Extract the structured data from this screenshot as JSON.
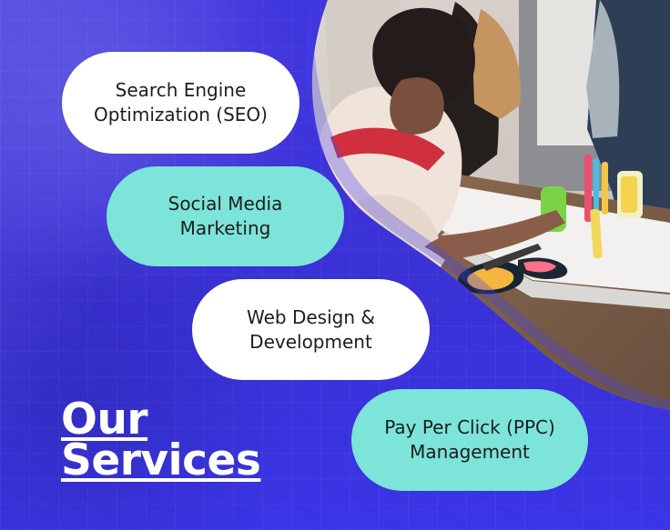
{
  "services": {
    "seo": "Search Engine\nOptimization (SEO)",
    "smm": "Social Media\nMarketing",
    "web": "Web Design &\nDevelopment",
    "ppc": "Pay Per Click (PPC)\nManagement"
  },
  "title": {
    "line1": "Our",
    "line2": "Services"
  },
  "colors": {
    "background_blue": "#3a34d8",
    "mint": "#7ce4d8",
    "white": "#ffffff"
  }
}
